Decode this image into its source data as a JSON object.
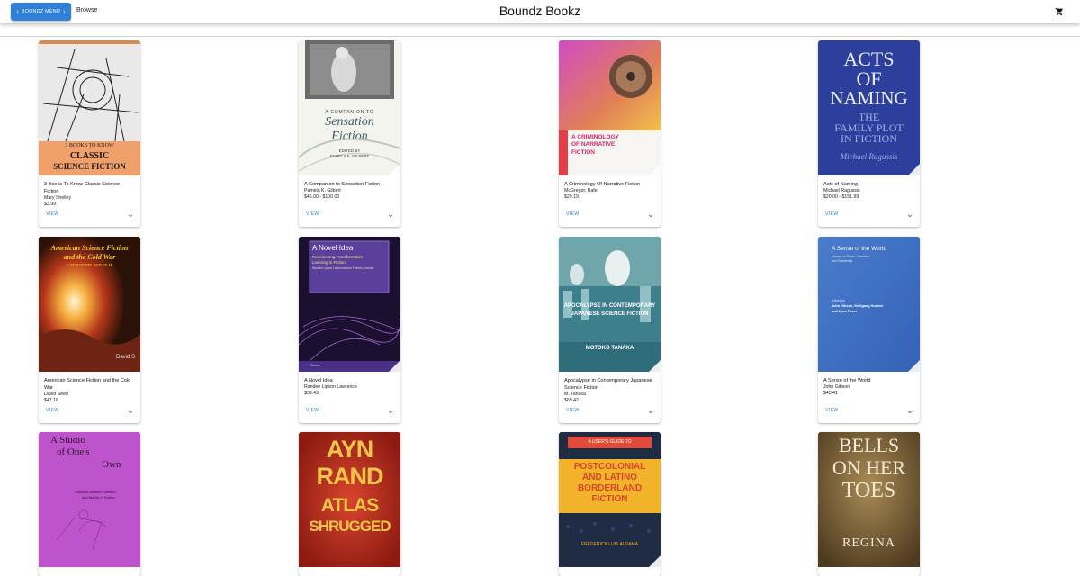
{
  "header": {
    "menu_button": "BOUNDZ MENU",
    "browse": "Browse",
    "title": "Boundz Bookz",
    "cart_icon": "cart-icon"
  },
  "books": [
    {
      "title": "3 Books To Know Classic Science-Fiction",
      "author": "Mary Shelley",
      "price": "$3.99",
      "view": "VIEW",
      "cover": {
        "bg": "#f0a06a",
        "lines": [
          "3 BOOKS TO KNOW",
          "CLASSIC",
          "SCIENCE FICTION"
        ]
      }
    },
    {
      "title": "A Companion to Sensation Fiction",
      "author": "Pamela K. Gilbert",
      "price": "$46.00 - $100.00",
      "view": "VIEW",
      "cover": {
        "bg": "#f4f4ee",
        "lines": [
          "A COMPANION TO",
          "Sensation",
          "Fiction",
          "EDITED BY",
          "PAMELA K. GILBERT"
        ]
      }
    },
    {
      "title": "A Criminology Of Narrative Fiction",
      "author": "McGregor, Rafe",
      "price": "$29.19",
      "view": "VIEW",
      "cover": {
        "bg": "#c33fb4",
        "lines": [
          "A CRIMINOLOGY",
          "OF NARRATIVE",
          "FICTION"
        ]
      }
    },
    {
      "title": "Acts of Naming",
      "author": "Michael Ragussis",
      "price": "$20.00 - $151.99",
      "view": "VIEW",
      "cover": {
        "bg": "#2c3f9c",
        "lines": [
          "ACTS",
          "OF",
          "NAMING",
          "THE",
          "FAMILY PLOT",
          "IN FICTION",
          "Michael Ragussis"
        ]
      }
    },
    {
      "title": "American Science Fiction and the Cold War",
      "author": "David Seed",
      "price": "$47.16",
      "view": "VIEW",
      "cover": {
        "bg": "#2a1208",
        "lines": [
          "American Science Fiction",
          "and the Cold War",
          "LITERATURE AND FILM",
          "David S"
        ]
      }
    },
    {
      "title": "A Novel Idea",
      "author": "Randee Lipson Lawrence",
      "price": "$39.49",
      "view": "VIEW",
      "cover": {
        "bg": "#24143e",
        "lines": [
          "A Novel Idea",
          "Researching Transformative",
          "Learning in Fiction",
          "Randee Lipson Lawrence and Patricia Cranton",
          "Sense"
        ]
      }
    },
    {
      "title": "Apocalypse in Contemporary Japanese Science Fiction",
      "author": "M. Tanaka",
      "price": "$69.42",
      "view": "VIEW",
      "cover": {
        "bg": "#4f8f9a",
        "lines": [
          "APOCALYPSE IN CONTEMPORARY",
          "JAPANESE SCIENCE FICTION",
          "MOTOKO TANAKA"
        ]
      }
    },
    {
      "title": "A Sense of the World",
      "author": "John Gibson",
      "price": "$43.41",
      "view": "VIEW",
      "cover": {
        "bg": "#3f71c5",
        "lines": [
          "A Sense of the World",
          "Essays on Fiction, Narrative,",
          "and Knowledge",
          "Edited by",
          "John Gibson, Wolfgang Huemer",
          "and Luca Pocci"
        ]
      }
    },
    {
      "title": "",
      "author": "",
      "price": "",
      "view": "",
      "cover": {
        "bg": "#b94dc8",
        "lines": [
          "A Studio",
          "of One's",
          "Own",
          "Fictional Women Painters",
          "and the Art of Fiction"
        ]
      }
    },
    {
      "title": "",
      "author": "",
      "price": "",
      "view": "",
      "cover": {
        "bg": "#b3271a",
        "lines": [
          "AYN",
          "RAND",
          "ATLAS",
          "SHRUGGED"
        ]
      }
    },
    {
      "title": "",
      "author": "",
      "price": "",
      "view": "",
      "cover": {
        "bg": "#23314a",
        "lines": [
          "A USER'S GUIDE TO",
          "POSTCOLONIAL",
          "AND LATINO",
          "BORDERLAND",
          "FICTION",
          "FREDERICK LUIS ALDAMA"
        ]
      }
    },
    {
      "title": "",
      "author": "",
      "price": "",
      "view": "",
      "cover": {
        "bg": "#6e5530",
        "lines": [
          "BELLS",
          "ON HER",
          "TOES",
          "REGINA"
        ]
      }
    }
  ]
}
